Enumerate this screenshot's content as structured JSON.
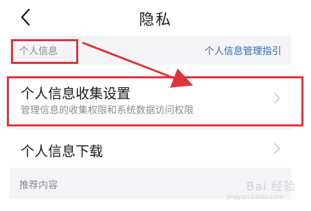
{
  "header": {
    "title": "隐私",
    "back_icon": "chevron-left-icon"
  },
  "section_personal": {
    "label": "个人信息",
    "link": "个人信息管理指引"
  },
  "items": [
    {
      "title": "个人信息收集设置",
      "subtitle": "管理信息的收集权限和系统数据访问权限"
    },
    {
      "title": "个人信息下载"
    }
  ],
  "section_recommend": {
    "label": "推荐内容"
  },
  "watermark": {
    "text": "Bai 经验",
    "sub": "jingyan.baidu.com"
  },
  "colors": {
    "highlight": "#e0323a",
    "link": "#2f6fb6",
    "section_bg": "#f4f4f6"
  }
}
